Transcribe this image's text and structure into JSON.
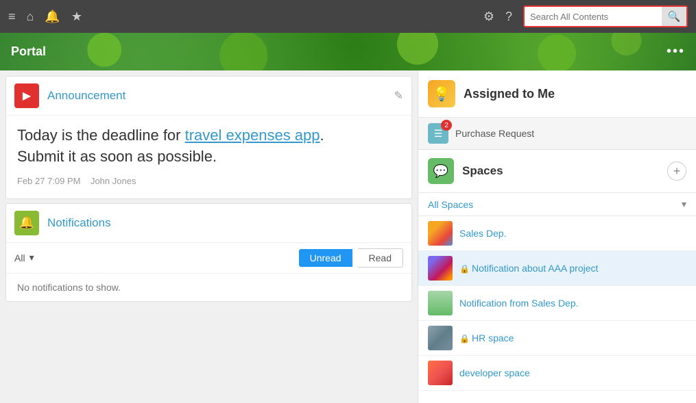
{
  "topbar": {
    "search_placeholder": "Search All Contents",
    "nav_icons": [
      "≡",
      "⌂",
      "🔔",
      "★",
      "⚙",
      "?"
    ]
  },
  "portal": {
    "title": "Portal",
    "dots": "•••"
  },
  "announcement": {
    "section_label": "Announcement",
    "body_line1": "Today is the deadline for ",
    "body_link": "travel expenses app",
    "body_period": ".",
    "body_line2": "Submit it as soon as possible.",
    "meta_date": "Feb 27 7:09 PM",
    "meta_author": "John Jones",
    "edit_icon": "✎"
  },
  "notifications": {
    "section_label": "Notifications",
    "filter_all": "All",
    "btn_unread": "Unread",
    "btn_read": "Read",
    "empty_message": "No notifications to show."
  },
  "assigned": {
    "section_label": "Assigned to Me",
    "item_label": "Purchase Request",
    "badge_count": "2"
  },
  "spaces": {
    "section_label": "Spaces",
    "all_label": "All Spaces",
    "add_icon": "+",
    "items": [
      {
        "name": "Sales Dep.",
        "locked": false,
        "active": false,
        "thumb_class": "thumb-sales"
      },
      {
        "name": "Notification about AAA project",
        "locked": true,
        "active": true,
        "thumb_class": "thumb-aaa"
      },
      {
        "name": "Notification from Sales Dep.",
        "locked": false,
        "active": false,
        "thumb_class": "thumb-notif-sales"
      },
      {
        "name": "HR space",
        "locked": true,
        "active": false,
        "thumb_class": "thumb-hr"
      },
      {
        "name": "developer space",
        "locked": false,
        "active": false,
        "thumb_class": "thumb-dev"
      }
    ]
  }
}
